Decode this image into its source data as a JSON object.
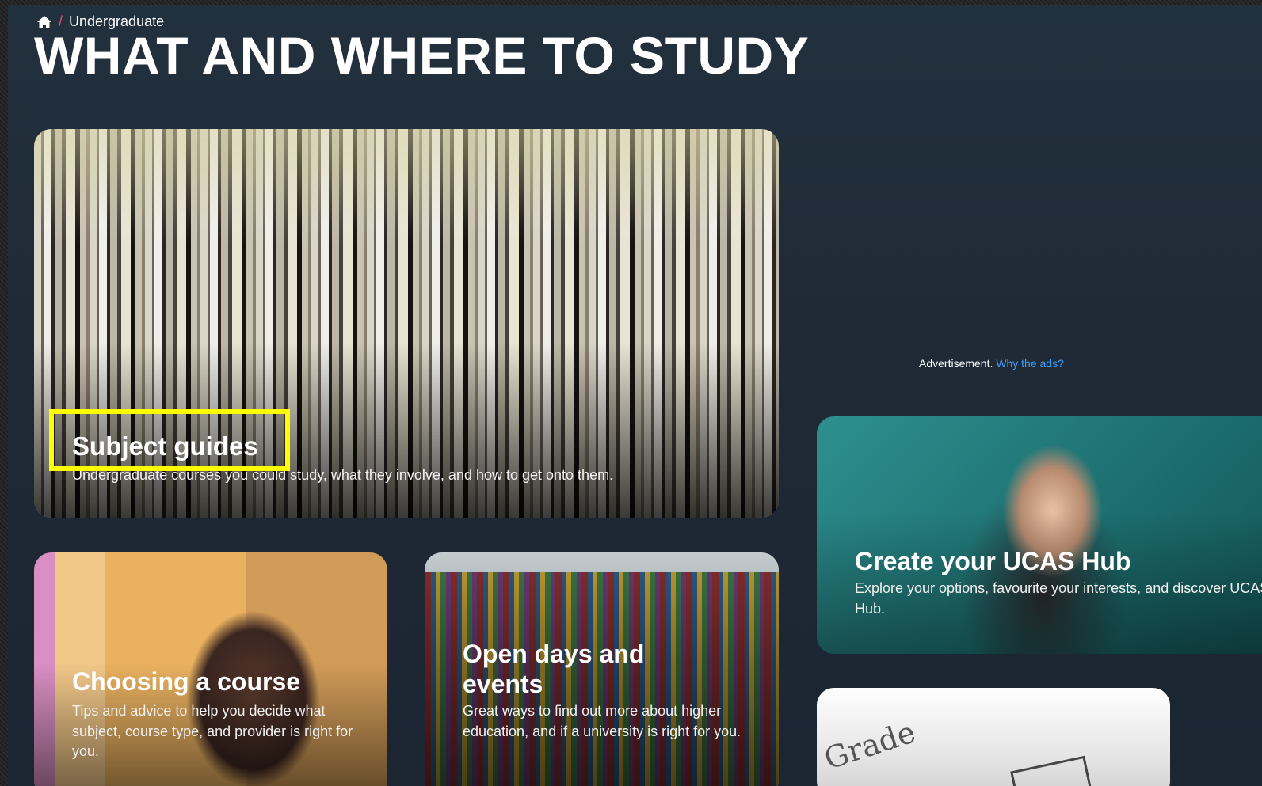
{
  "breadcrumb": {
    "home_icon": "home-icon",
    "separator": "/",
    "current": "Undergraduate"
  },
  "page_title": "WHAT AND WHERE TO STUDY",
  "cards": {
    "subject_guides": {
      "title": "Subject guides",
      "description": "Undergraduate courses you could study, what they involve, and how to get onto them."
    },
    "choosing_course": {
      "title": "Choosing a course",
      "description": "Tips and advice to help you decide what subject, course type, and provider is right for you."
    },
    "open_days": {
      "title": "Open days and events",
      "description": "Great ways to find out more about higher education, and if a university is right for you."
    },
    "ucas_hub": {
      "title": "Create your UCAS Hub",
      "description": "Explore your options, favourite your interests, and discover UCAS Hub."
    },
    "grade": {
      "image_text": "Grade"
    }
  },
  "advertisement": {
    "label": "Advertisement.",
    "link": "Why the ads?"
  },
  "colors": {
    "background": "#1c2633",
    "highlight": "#ffff00",
    "breadcrumb_separator": "#e0566a",
    "ad_link": "#3aa0ff"
  }
}
